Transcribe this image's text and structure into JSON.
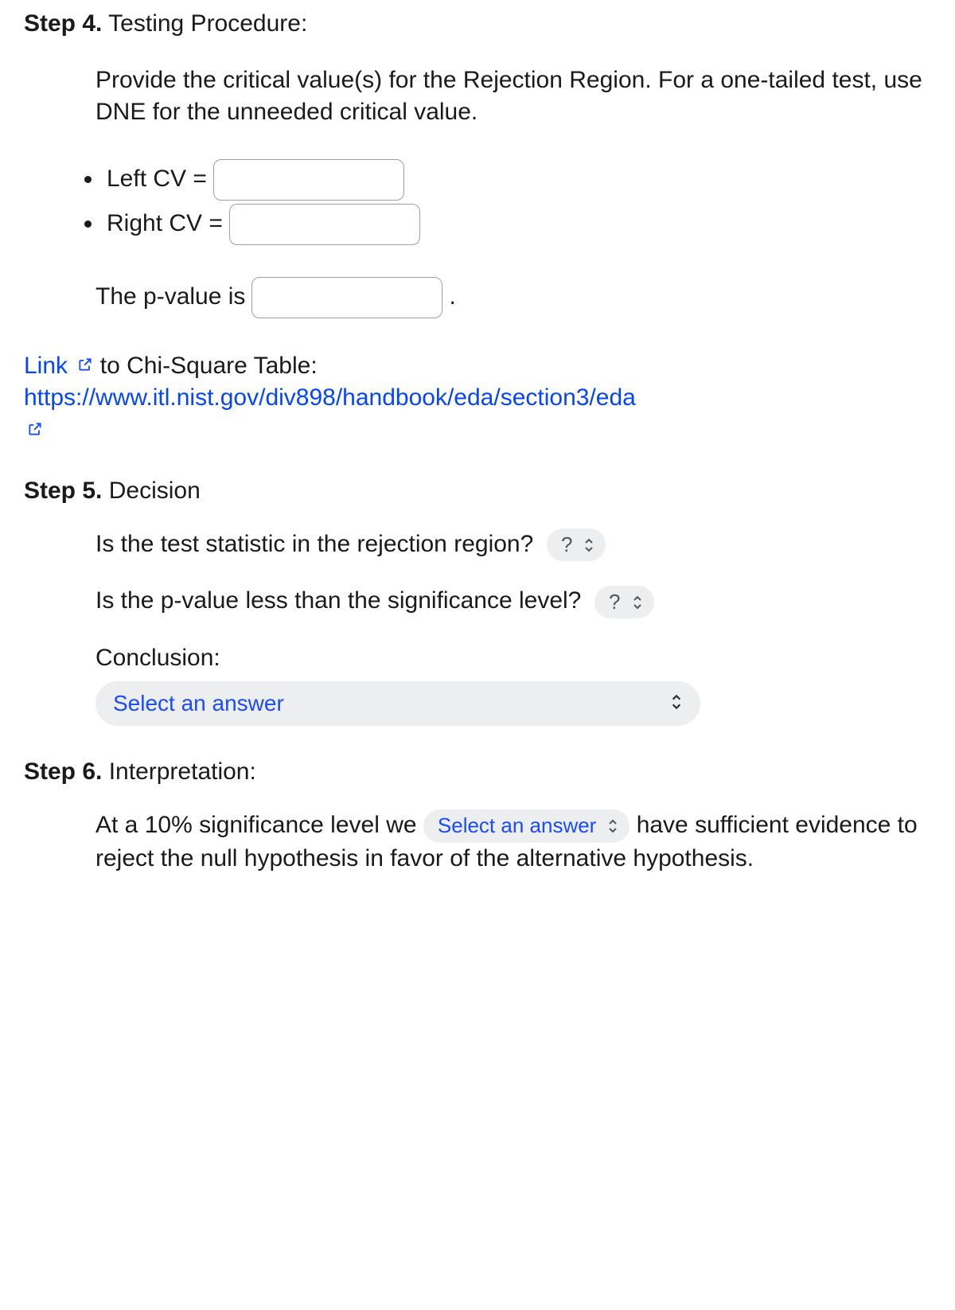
{
  "step4": {
    "label": "Step 4.",
    "title": "Testing Procedure:",
    "instruction": "Provide the critical value(s) for the Rejection Region. For a one-tailed test, use DNE for the unneeded critical value.",
    "left_cv_label": "Left CV =",
    "right_cv_label": "Right CV =",
    "pvalue_prefix": "The p-value is",
    "pvalue_suffix": "."
  },
  "link_block": {
    "prefix": "Link",
    "mid": " to Chi-Square Table:",
    "url_text": "https://www.itl.nist.gov/div898/handbook/eda/section3/eda"
  },
  "step5": {
    "label": "Step 5.",
    "title": "Decision",
    "q1": "Is the test statistic in the rejection region?",
    "q2": "Is the p-value less than the significance level?",
    "q_select_placeholder": "?",
    "conclusion_label": "Conclusion:",
    "conclusion_placeholder": "Select an answer"
  },
  "step6": {
    "label": "Step 6.",
    "title": "Interpretation:",
    "text_a": "At a 10% significance level we ",
    "select_placeholder": "Select an answer",
    "text_b": " have sufficient evidence to reject the null hypothesis in favor of the alternative hypothesis."
  }
}
